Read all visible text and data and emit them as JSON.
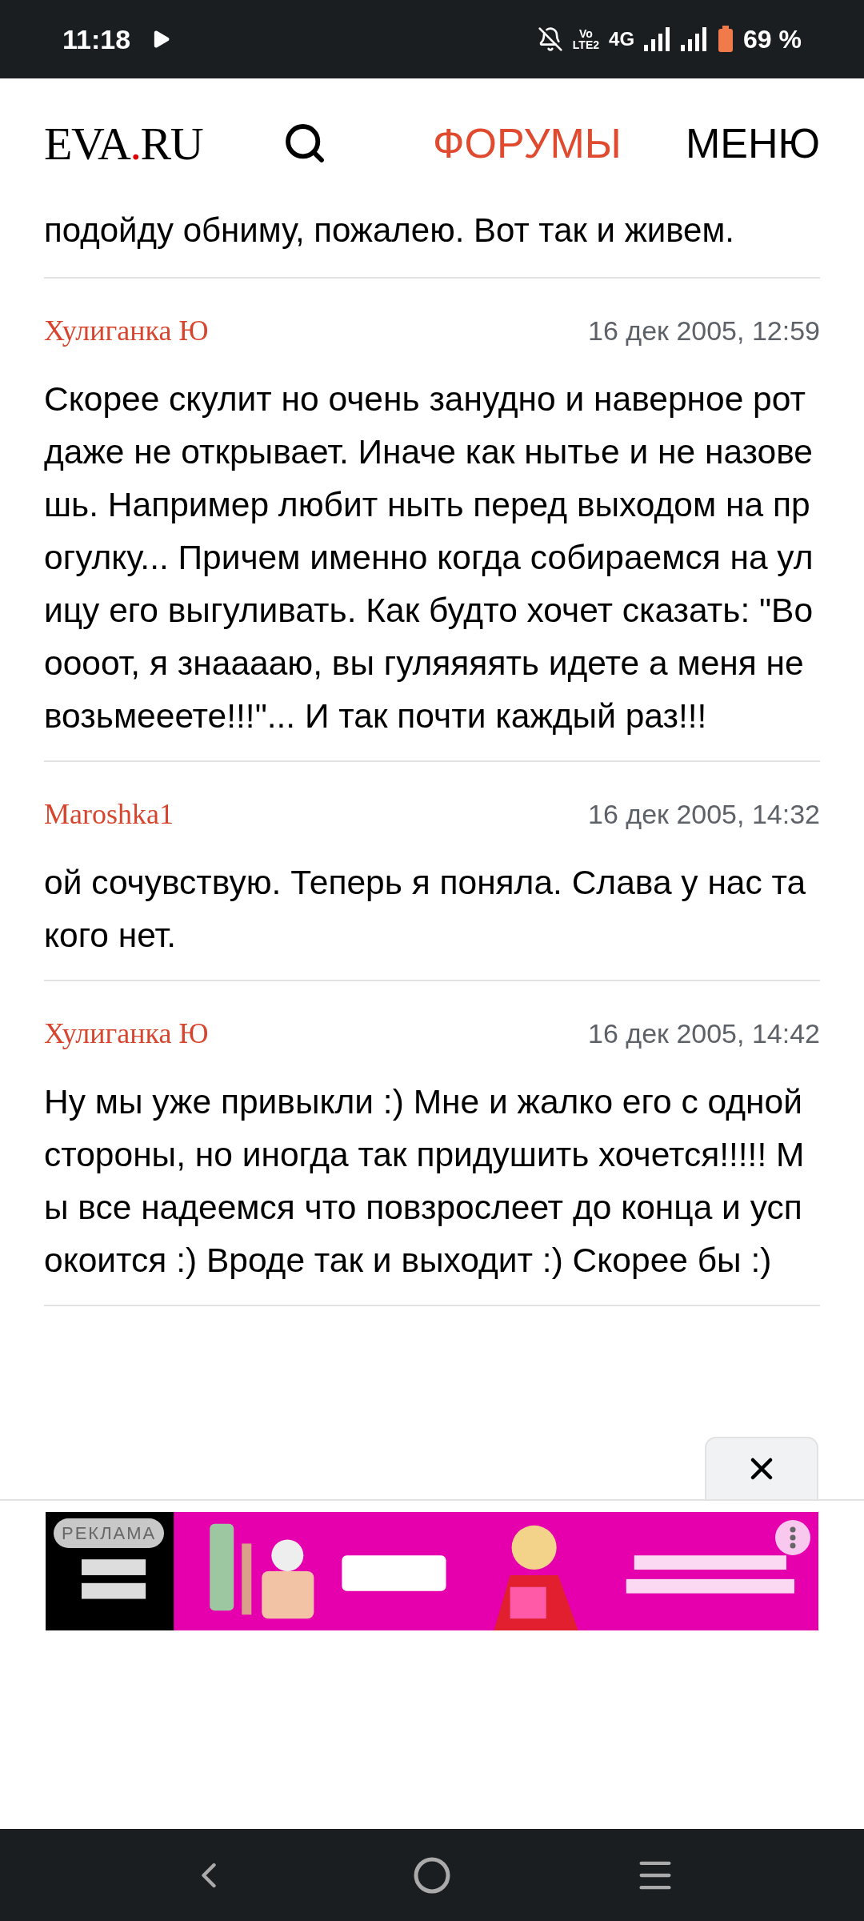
{
  "status_bar": {
    "time": "11:18",
    "volte_top": "Vo",
    "volte_bottom": "LTE2",
    "network": "4G",
    "battery": "69 %"
  },
  "header": {
    "logo": {
      "before": "EVA",
      "dot": ".",
      "after": "RU"
    },
    "nav": [
      {
        "label": "ФОРУМЫ",
        "selected": true
      },
      {
        "label": "МЕНЮ",
        "selected": false
      }
    ]
  },
  "previous_post": {
    "text": "подойду обниму, пожалею. Вот так и живем."
  },
  "posts": [
    {
      "author": "Хулиганка Ю",
      "date": "16 дек 2005, 12:59",
      "text": "Скорее скулит но очень занудно и наверное рот даже не открывает. Иначе как нытье и не назовешь. Например любит ныть перед выходом на прогулку... Причем именно когда собираемся на улицу его выгуливать. Как будто хочет сказать: \"Вооооот, я знааааю, вы гуляяяять идете а меня не возьмееете!!!\"... И так почти каждый раз!!!"
    },
    {
      "author": "Maroshka1",
      "date": "16 дек 2005, 14:32",
      "text": "ой сочувствую. Теперь я поняла. Слава у нас такого нет."
    },
    {
      "author": "Хулиганка Ю",
      "date": "16 дек 2005, 14:42",
      "text": "Ну мы уже привыкли :) Мне и жалко его с одной стороны, но иногда так придушить хочется!!!!! Мы все надеемся что повзрослеет до конца и успокоится :) Вроде так и выходит :) Скорее бы :)"
    }
  ],
  "ad": {
    "label": "РЕКЛАМА",
    "kind": "picture"
  }
}
